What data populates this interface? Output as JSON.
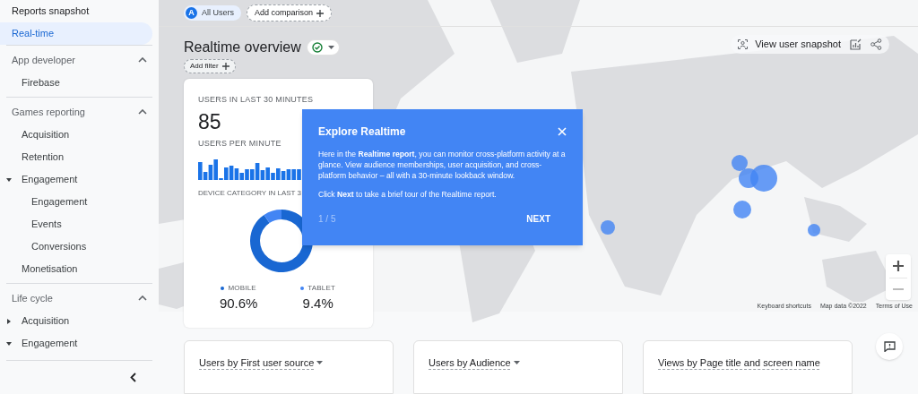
{
  "sidebar": {
    "items": [
      {
        "kind": "link",
        "label": "Reports snapshot",
        "selected": false
      },
      {
        "kind": "link",
        "label": "Real-time",
        "selected": true
      },
      {
        "kind": "section",
        "label": "App developer",
        "expanded": true,
        "children": [
          {
            "label": "Firebase"
          }
        ]
      },
      {
        "kind": "section",
        "label": "Games reporting",
        "expanded": true,
        "children": [
          {
            "label": "Acquisition"
          },
          {
            "label": "Retention"
          },
          {
            "label": "Engagement",
            "expanded": true,
            "children": [
              {
                "label": "Engagement"
              },
              {
                "label": "Events"
              },
              {
                "label": "Conversions"
              }
            ]
          },
          {
            "label": "Monetisation"
          }
        ]
      },
      {
        "kind": "section",
        "label": "Life cycle",
        "expanded": true,
        "children": [
          {
            "label": "Acquisition",
            "expanded": false
          },
          {
            "label": "Engagement",
            "expanded": true
          }
        ]
      }
    ]
  },
  "comparison": {
    "avatar_letter": "A",
    "segment": "All Users",
    "add_label": "Add comparison"
  },
  "page": {
    "title": "Realtime overview",
    "add_filter": "Add filter"
  },
  "toolbar": {
    "snapshot_label": "View user snapshot"
  },
  "summary_card": {
    "users_label": "USERS IN LAST 30 MINUTES",
    "users_value": "85",
    "per_minute_label": "USERS PER MINUTE",
    "device_label": "DEVICE CATEGORY IN LAST 3",
    "chart_data": {
      "type": "donut",
      "categories": [
        "MOBILE",
        "TABLET"
      ],
      "values": [
        90.6,
        9.4
      ],
      "colors": [
        "#1967d2",
        "#4285f4"
      ],
      "value_labels": [
        "90.6%",
        "9.4%"
      ]
    }
  },
  "dialog": {
    "title": "Explore Realtime",
    "body": [
      "Here in the **Realtime report**, you can monitor cross-platform activity at a glance. View audience memberships, user acquisition, and cross-platform behavior – all with a 30-minute lookback window.",
      "Click **Next** to take a brief tour of the Realtime report."
    ],
    "step": "1 / 5",
    "next_label": "NEXT"
  },
  "map": {
    "attribution": [
      "Keyboard shortcuts",
      "Map data ©2022",
      "Terms of Use"
    ]
  },
  "bottom_cards": [
    {
      "title": "Users by First user source",
      "has_dropdown": true
    },
    {
      "title": "Users by Audience",
      "has_dropdown": true
    },
    {
      "title": "Views by Page title and screen name",
      "has_dropdown": false
    }
  ]
}
